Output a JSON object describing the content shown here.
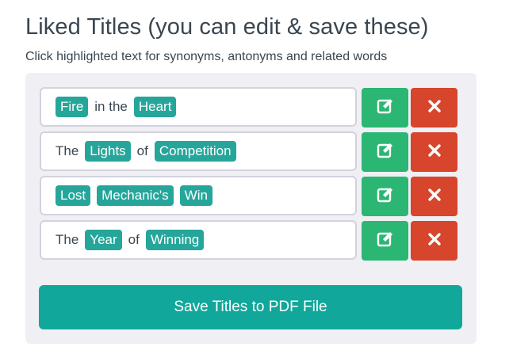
{
  "header": {
    "title": "Liked Titles (you can edit & save these)",
    "subtitle": "Click highlighted text for synonyms, antonyms and related words"
  },
  "titles": [
    {
      "parts": [
        {
          "text": "Fire",
          "highlighted": true
        },
        {
          "text": "in the",
          "highlighted": false
        },
        {
          "text": "Heart",
          "highlighted": true
        }
      ]
    },
    {
      "parts": [
        {
          "text": "The",
          "highlighted": false
        },
        {
          "text": "Lights",
          "highlighted": true
        },
        {
          "text": "of",
          "highlighted": false
        },
        {
          "text": "Competition",
          "highlighted": true
        }
      ]
    },
    {
      "parts": [
        {
          "text": "Lost",
          "highlighted": true
        },
        {
          "text": "Mechanic's",
          "highlighted": true
        },
        {
          "text": "Win",
          "highlighted": true
        }
      ]
    },
    {
      "parts": [
        {
          "text": "The",
          "highlighted": false
        },
        {
          "text": "Year",
          "highlighted": true
        },
        {
          "text": "of",
          "highlighted": false
        },
        {
          "text": "Winning",
          "highlighted": true
        }
      ]
    }
  ],
  "row_actions": {
    "edit_icon": "edit-icon",
    "delete_icon": "close-icon"
  },
  "save_button": {
    "label": "Save Titles to PDF File"
  },
  "colors": {
    "highlight": "#26a69a",
    "edit": "#2bb673",
    "delete": "#d6452c",
    "save": "#11a89b",
    "panel": "#efeff4",
    "text": "#3a4650"
  }
}
